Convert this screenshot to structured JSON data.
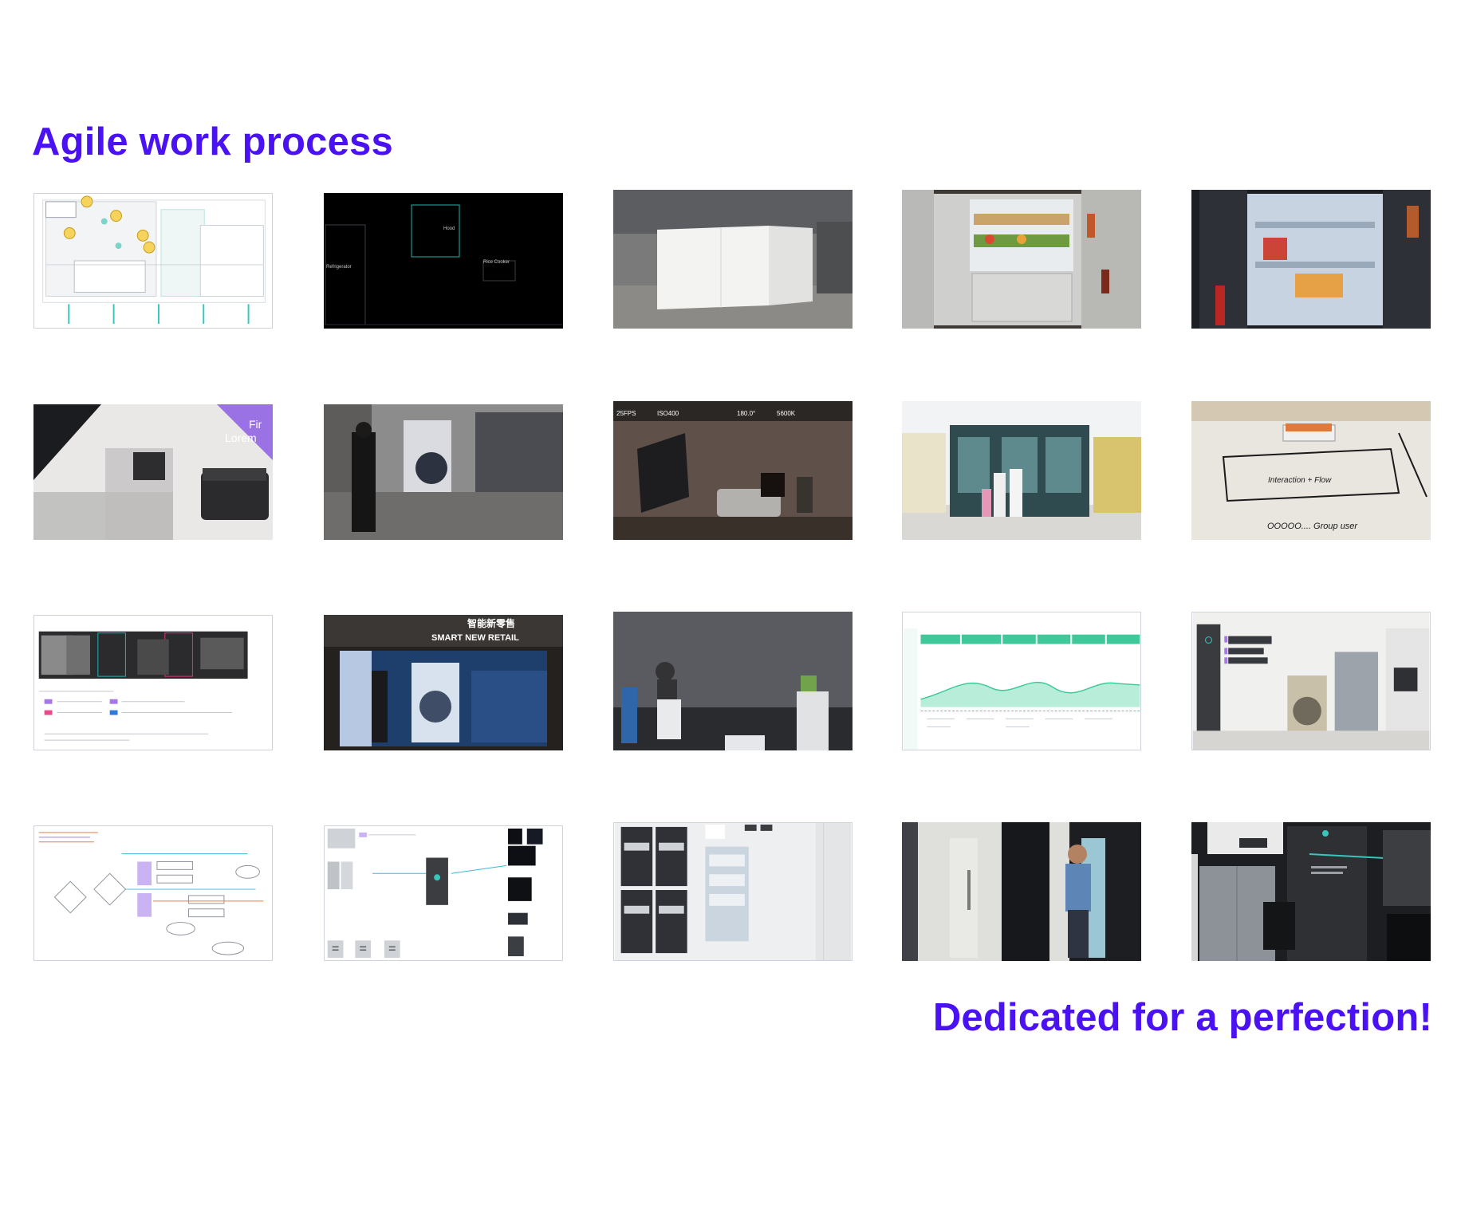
{
  "page": {
    "title": "Agile work process",
    "tagline": "Dedicated for a perfection!",
    "accent_color": "#4a12f2"
  },
  "thumbnails": {
    "r1c1": {
      "icon": "floorplan-sketch"
    },
    "r1c2": {
      "labels": [
        "Refrigerator",
        "Hood",
        "Rice Cooker"
      ]
    },
    "r1c3": {
      "icon": "room-mockup-photo"
    },
    "r1c4": {
      "icon": "open-fridge-photo"
    },
    "r1c5": {
      "icon": "fridge-interior-photo"
    },
    "r2c1": {
      "labels": [
        "Fir",
        "Lorem"
      ]
    },
    "r2c2": {
      "icon": "showroom-visitor-photo"
    },
    "r2c3": {
      "labels": [
        "25FPS",
        "ISO400",
        "180.0°",
        "5600K"
      ]
    },
    "r2c4": {
      "icon": "retail-display-photo"
    },
    "r2c5": {
      "labels": [
        "Interaction + Flow",
        "OOOOO.... Group user"
      ]
    },
    "r3c1": {
      "icon": "storyboard-board"
    },
    "r3c2": {
      "labels": [
        "智能新零售",
        "SMART NEW RETAIL"
      ]
    },
    "r3c3": {
      "icon": "interactive-screen-photo"
    },
    "r3c4": {
      "icon": "journey-map"
    },
    "r3c5": {
      "icon": "kitchen-render"
    },
    "r4c1": {
      "icon": "flowchart"
    },
    "r4c2": {
      "icon": "wireframe-flow"
    },
    "r4c3": {
      "icon": "ui-wireframes"
    },
    "r4c4": {
      "icon": "person-with-fridge-photo"
    },
    "r4c5": {
      "icon": "dark-fridge-ui-render"
    }
  }
}
